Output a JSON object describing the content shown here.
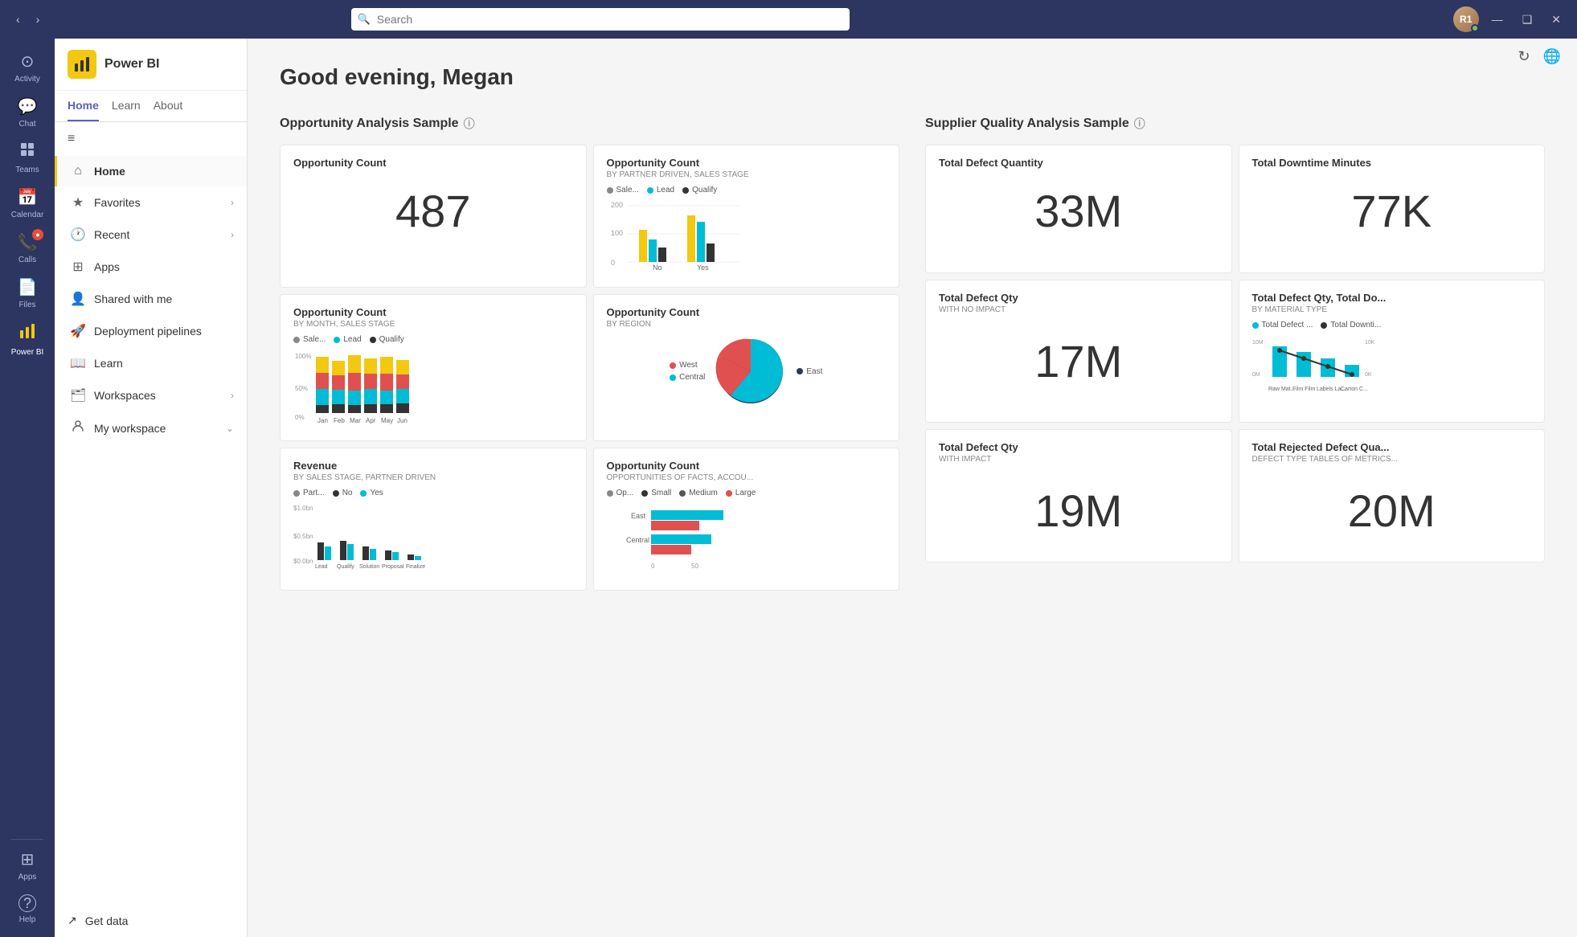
{
  "titlebar": {
    "search_placeholder": "Search",
    "nav_back": "‹",
    "nav_forward": "›",
    "window_minimize": "—",
    "window_maximize": "❑",
    "window_close": "✕",
    "avatar_initials": "R1"
  },
  "rail": {
    "items": [
      {
        "id": "activity",
        "label": "Activity",
        "icon": "⊙",
        "active": false
      },
      {
        "id": "chat",
        "label": "Chat",
        "icon": "💬",
        "active": false,
        "badge": ""
      },
      {
        "id": "teams",
        "label": "Teams",
        "icon": "⊞",
        "active": false
      },
      {
        "id": "calendar",
        "label": "Calendar",
        "icon": "📅",
        "active": false
      },
      {
        "id": "calls",
        "label": "Calls",
        "icon": "📞",
        "active": false,
        "badge": "●"
      },
      {
        "id": "files",
        "label": "Files",
        "icon": "📄",
        "active": false
      },
      {
        "id": "powerbi",
        "label": "Power BI",
        "icon": "⬛",
        "active": true
      }
    ],
    "bottom_items": [
      {
        "id": "apps",
        "label": "Apps",
        "icon": "⊞",
        "active": false
      },
      {
        "id": "help",
        "label": "Help",
        "icon": "?",
        "active": false
      }
    ]
  },
  "sidebar": {
    "logo_icon": "⬛",
    "logo_text": "Power BI",
    "tabs": [
      {
        "id": "home",
        "label": "Home",
        "active": true
      },
      {
        "id": "learn",
        "label": "Learn",
        "active": false
      },
      {
        "id": "about",
        "label": "About",
        "active": false
      }
    ],
    "nav_items": [
      {
        "id": "home",
        "label": "Home",
        "icon": "⌂",
        "active": true
      },
      {
        "id": "favorites",
        "label": "Favorites",
        "icon": "★",
        "active": false,
        "chevron": true
      },
      {
        "id": "recent",
        "label": "Recent",
        "icon": "🕐",
        "active": false,
        "chevron": true
      },
      {
        "id": "apps",
        "label": "Apps",
        "icon": "⊞",
        "active": false
      },
      {
        "id": "shared",
        "label": "Shared with me",
        "icon": "👤",
        "active": false
      },
      {
        "id": "deployment",
        "label": "Deployment pipelines",
        "icon": "🚀",
        "active": false
      },
      {
        "id": "learn",
        "label": "Learn",
        "icon": "📖",
        "active": false
      },
      {
        "id": "workspaces",
        "label": "Workspaces",
        "icon": "🗂",
        "active": false,
        "chevron": true
      },
      {
        "id": "myworkspace",
        "label": "My workspace",
        "icon": "👤",
        "active": false,
        "chevron_down": true
      }
    ],
    "get_data_label": "Get data"
  },
  "main": {
    "greeting": "Good evening, ",
    "greeting_name": "Megan",
    "top_actions": {
      "refresh": "↻",
      "globe": "🌐"
    },
    "sections": [
      {
        "id": "opportunity",
        "title": "Opportunity Analysis Sample",
        "tiles": [
          {
            "id": "opp-count",
            "title": "Opportunity Count",
            "subtitle": "",
            "type": "big-number",
            "value": "487"
          },
          {
            "id": "opp-count-partner",
            "title": "Opportunity Count",
            "subtitle": "BY PARTNER DRIVEN, SALES STAGE",
            "type": "bar-chart",
            "legend": [
              {
                "label": "Sale...",
                "color": "#888"
              },
              {
                "label": "Lead",
                "color": "#00bcd4"
              },
              {
                "label": "Qualify",
                "color": "#333"
              }
            ],
            "chart_type": "grouped-bar",
            "xLabels": [
              "No",
              "Yes"
            ],
            "yMax": 200
          },
          {
            "id": "opp-count-month",
            "title": "Opportunity Count",
            "subtitle": "BY MONTH, SALES STAGE",
            "type": "stacked-bar",
            "legend": [
              {
                "label": "Sale...",
                "color": "#888"
              },
              {
                "label": "Lead",
                "color": "#00bcd4"
              },
              {
                "label": "Qualify",
                "color": "#333"
              }
            ],
            "xLabels": [
              "Jan",
              "Feb",
              "Mar",
              "Apr",
              "May",
              "Jun"
            ],
            "yLabels": [
              "100%",
              "50%",
              "0%"
            ]
          },
          {
            "id": "opp-count-region",
            "title": "Opportunity Count",
            "subtitle": "BY REGION",
            "type": "pie",
            "legend": [
              {
                "label": "West",
                "color": "#e05050"
              },
              {
                "label": "Central",
                "color": "#00bcd4"
              },
              {
                "label": "East",
                "color": "#2d3561"
              }
            ]
          },
          {
            "id": "revenue",
            "title": "Revenue",
            "subtitle": "BY SALES STAGE, PARTNER DRIVEN",
            "type": "bar-chart",
            "legend": [
              {
                "label": "Part...",
                "color": "#888"
              },
              {
                "label": "No",
                "color": "#333"
              },
              {
                "label": "Yes",
                "color": "#00bcd4"
              }
            ],
            "xLabels": [
              "Lead",
              "Qualify",
              "Solution",
              "Proposal",
              "Finalize"
            ],
            "yLabels": [
              "$1.0bn",
              "$0.5bn",
              "$0.0bn"
            ]
          },
          {
            "id": "opp-count-facts",
            "title": "Opportunity Count",
            "subtitle": "OPPORTUNITIES OF FACTS, ACCOU...",
            "type": "horizontal-bar",
            "legend": [
              {
                "label": "Op...",
                "color": "#888"
              },
              {
                "label": "Small",
                "color": "#333"
              },
              {
                "label": "Medium",
                "color": "#555"
              },
              {
                "label": "Large",
                "color": "#e05050"
              }
            ],
            "rows": [
              "East",
              "Central"
            ]
          }
        ]
      },
      {
        "id": "supplier",
        "title": "Supplier Quality Analysis Sample",
        "tiles": [
          {
            "id": "total-defect-qty",
            "title": "Total Defect Quantity",
            "subtitle": "",
            "type": "big-number",
            "value": "33M"
          },
          {
            "id": "total-downtime-min",
            "title": "Total Downtime Minutes",
            "subtitle": "",
            "type": "big-number",
            "value": "77K"
          },
          {
            "id": "total-defect-no-impact",
            "title": "Total Defect Qty",
            "subtitle": "WITH NO IMPACT",
            "type": "big-number",
            "value": "17M"
          },
          {
            "id": "total-defect-material",
            "title": "Total Defect Qty, Total Do...",
            "subtitle": "BY MATERIAL TYPE",
            "type": "combo-chart",
            "legend": [
              {
                "label": "Total Defect ...",
                "color": "#00bcd4"
              },
              {
                "label": "Total Downti...",
                "color": "#333"
              }
            ],
            "yLeft": [
              "10M",
              "0M"
            ],
            "yRight": [
              "10K",
              "0K"
            ],
            "xLabels": [
              "Raw Mat...",
              "Film Film",
              "Labels La...",
              "Carton C..."
            ]
          },
          {
            "id": "total-defect-impact",
            "title": "Total Defect Qty",
            "subtitle": "WITH IMPACT",
            "type": "big-number",
            "value": "19M"
          },
          {
            "id": "total-rejected",
            "title": "Total Rejected Defect Qua...",
            "subtitle": "DEFECT TYPE TABLES OF METRICS...",
            "type": "big-number",
            "value": "20M"
          }
        ]
      }
    ]
  }
}
